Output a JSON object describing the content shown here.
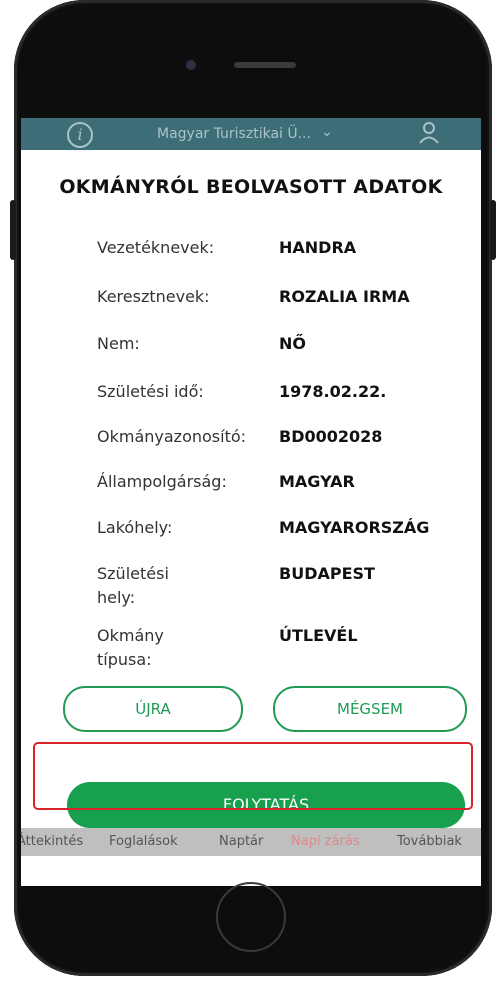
{
  "header": {
    "title": "Magyar Turisztikai Ü...",
    "info_icon_glyph": "i",
    "chevron_glyph": "⌄",
    "user_glyph": "👤"
  },
  "modal": {
    "title": "OKMÁNYRÓL BEOLVASOTT ADATOK",
    "fields": [
      {
        "label": "Vezetéknevek:",
        "value": "HANDRA"
      },
      {
        "label": "Keresztnevek:",
        "value": "ROZALIA IRMA"
      },
      {
        "label": "Nem:",
        "value": "NŐ"
      },
      {
        "label": "Születési idő:",
        "value": "1978.02.22."
      },
      {
        "label": "Okmányazonosító:",
        "value": "BD0002028"
      },
      {
        "label": "Állampolgárság:",
        "value": "MAGYAR"
      },
      {
        "label": "Lakóhely:",
        "value": "MAGYARORSZÁG"
      },
      {
        "label": "Születési hely:",
        "value": "BUDAPEST"
      },
      {
        "label": "Okmány típusa:",
        "value": "ÚTLEVÉL"
      }
    ],
    "retry_label": "ÚJRA",
    "cancel_label": "MÉGSEM",
    "continue_label": "FOLYTATÁS"
  },
  "bottom_nav": {
    "items": [
      "Áttekintés",
      "Foglalások",
      "Naptár",
      "Napi zárás",
      "Továbbiak"
    ],
    "active_index": 3
  },
  "colors": {
    "brand_green": "#17a04d",
    "header_teal": "#3d6e77",
    "highlight_red": "#d8242a",
    "active_nav": "#d98a8a"
  }
}
